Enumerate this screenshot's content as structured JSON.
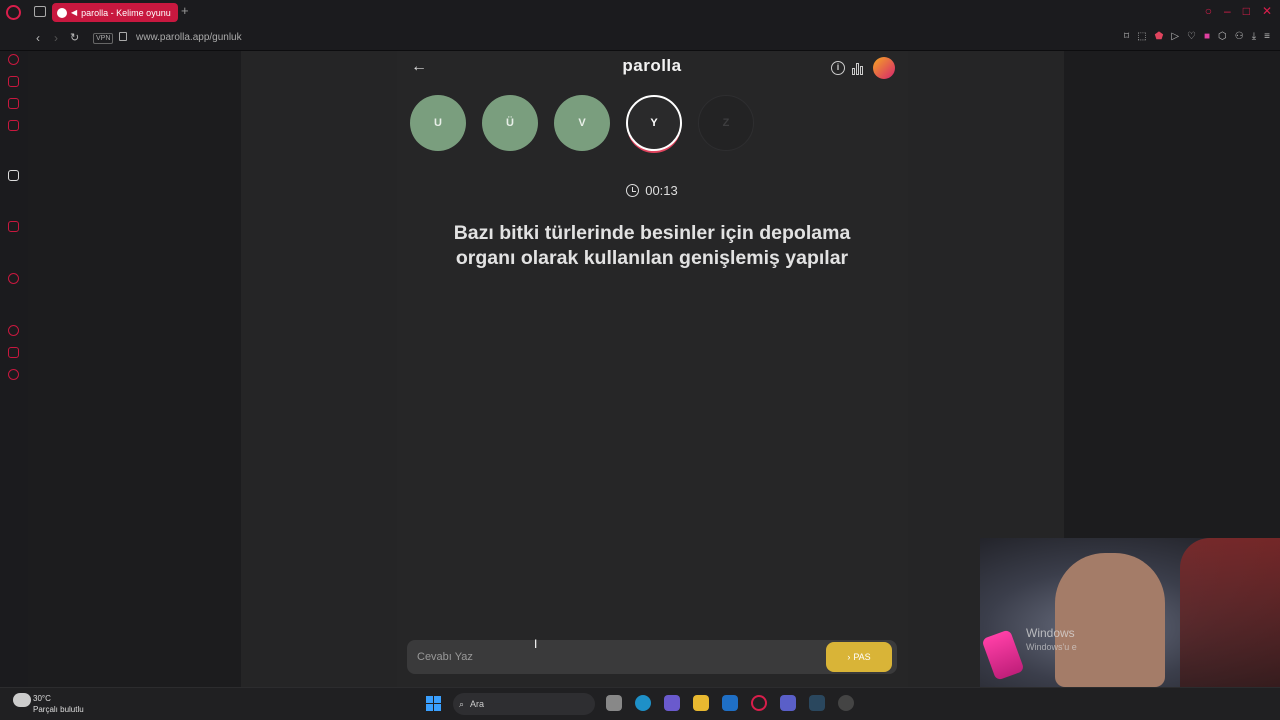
{
  "browser": {
    "tab_title": "parolla - Kelime oyunu",
    "new_tab": "+",
    "vpn_label": "VPN",
    "url": "www.parolla.app/gunluk"
  },
  "header": {
    "back": "←",
    "title": "parolla",
    "info": "i"
  },
  "letters": [
    {
      "letter": "U",
      "state": "done"
    },
    {
      "letter": "Ü",
      "state": "done"
    },
    {
      "letter": "V",
      "state": "done"
    },
    {
      "letter": "Y",
      "state": "active"
    },
    {
      "letter": "Z",
      "state": "future"
    }
  ],
  "timer": "00:13",
  "question": "Bazı bitki türlerinde besinler için depolama organı olarak kullanılan genişlemiş yapılar",
  "answer": {
    "placeholder": "Cevabı Yaz",
    "value": "",
    "pass_label": "PAS",
    "pass_icon": "›"
  },
  "watermark": {
    "line1": "Windows",
    "line2": "Windows'u e"
  },
  "taskbar": {
    "weather_temp": "30°C",
    "weather_desc": "Parçalı bulutlu",
    "search_label": "Ara"
  },
  "colors": {
    "done": "#7a9e7e",
    "active_ring": "#ffffff",
    "accent_pink": "#e0445e",
    "pass_button": "#d9b437",
    "browser_accent": "#c8183f"
  }
}
